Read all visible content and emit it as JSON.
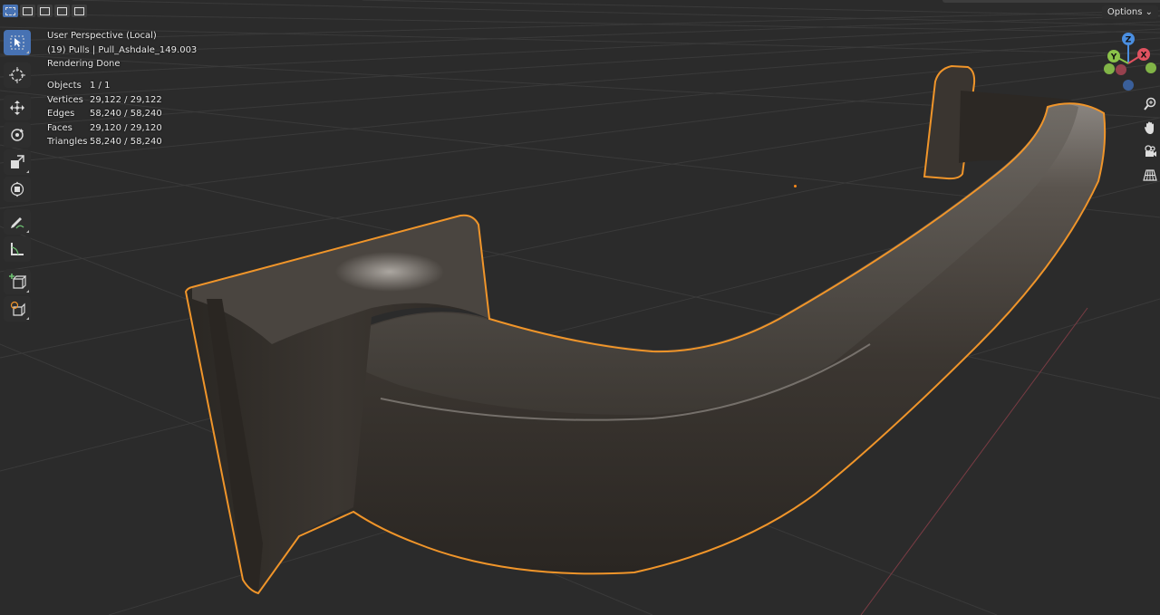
{
  "header": {
    "view_name": "User Perspective (Local)",
    "object_info": "(19) Pulls | Pull_Ashdale_149.003",
    "status": "Rendering Done"
  },
  "stats": [
    {
      "label": "Objects",
      "value": "1 / 1"
    },
    {
      "label": "Vertices",
      "value": "29,122 / 29,122"
    },
    {
      "label": "Edges",
      "value": "58,240 / 58,240"
    },
    {
      "label": "Faces",
      "value": "29,120 / 29,120"
    },
    {
      "label": "Triangles",
      "value": "58,240 / 58,240"
    }
  ],
  "options_label": "Options",
  "gizmo": {
    "x": "X",
    "y": "Y",
    "z": "Z"
  },
  "toolbar": [
    {
      "name": "select-box",
      "icon": "cursor-arrow-icon",
      "active": true
    },
    {
      "name": "cursor",
      "icon": "3d-cursor-icon"
    },
    {
      "name": "move",
      "icon": "move-arrows-icon"
    },
    {
      "name": "rotate",
      "icon": "rotate-icon"
    },
    {
      "name": "scale",
      "icon": "scale-icon"
    },
    {
      "name": "transform",
      "icon": "transform-icon"
    },
    {
      "name": "annotate",
      "icon": "annotate-pen-icon"
    },
    {
      "name": "measure",
      "icon": "measure-ruler-icon"
    },
    {
      "name": "add-cube",
      "icon": "add-cube-icon"
    },
    {
      "name": "add-cube-extra",
      "icon": "add-primitive-icon"
    }
  ],
  "colors": {
    "background": "#2b2b2b",
    "grid": "#3a3a3a",
    "selection_outline": "#f0952a",
    "active_tool": "#4772b3",
    "axis_x": "#e05260",
    "axis_y": "#8bc34a",
    "axis_z": "#4a8ee0"
  }
}
